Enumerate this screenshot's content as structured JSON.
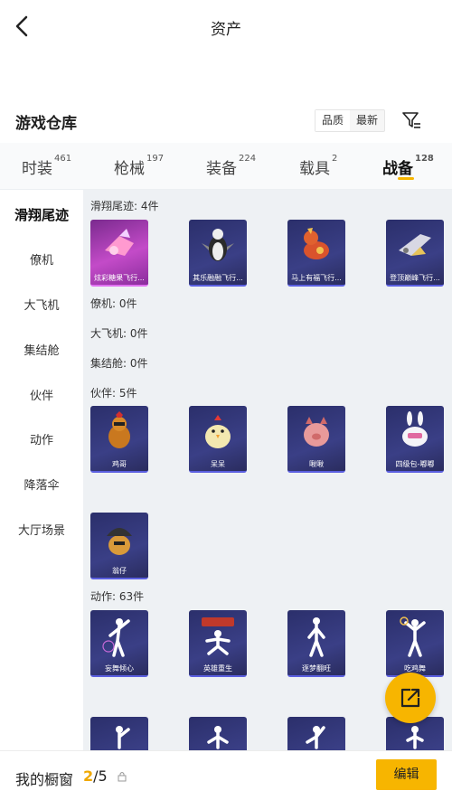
{
  "header": {
    "title": "资产"
  },
  "section": {
    "title": "游戏仓库"
  },
  "sort": {
    "quality_label": "品质",
    "latest_label": "最新"
  },
  "tabs": [
    {
      "label": "时装",
      "count": "461"
    },
    {
      "label": "枪械",
      "count": "197"
    },
    {
      "label": "装备",
      "count": "224"
    },
    {
      "label": "载具",
      "count": "2"
    },
    {
      "label": "战备",
      "count": "128"
    }
  ],
  "sidebar": [
    {
      "label": "滑翔尾迹"
    },
    {
      "label": "僚机"
    },
    {
      "label": "大飞机"
    },
    {
      "label": "集结舱"
    },
    {
      "label": "伙伴"
    },
    {
      "label": "动作"
    },
    {
      "label": "降落伞"
    },
    {
      "label": "大厅场景"
    }
  ],
  "groups": {
    "glide": {
      "title": "滑翔尾迹: 4件",
      "items": [
        "炫彩糖果飞行...",
        "其乐融融飞行...",
        "马上有福飞行...",
        "登顶巅峰飞行..."
      ]
    },
    "wingman": {
      "title": "僚机: 0件"
    },
    "plane": {
      "title": "大飞机: 0件"
    },
    "pod": {
      "title": "集结舱: 0件"
    },
    "buddy": {
      "title": "伙伴: 5件",
      "items": [
        "鸡哥",
        "呆呆",
        "啾啾",
        "四级包-嘟嘟",
        "翁仔"
      ]
    },
    "emote": {
      "title": "动作: 63件",
      "items": [
        "妄舞倾心",
        "英雄重生",
        "逐梦翻旺",
        "吃鸡舞"
      ]
    }
  },
  "bottom": {
    "window_label": "我的橱窗",
    "window_used": "2",
    "window_total": "/5",
    "edit_label": "编辑"
  },
  "colors": {
    "accent": "#f7b500",
    "card_bg": "#2b2f6b"
  }
}
